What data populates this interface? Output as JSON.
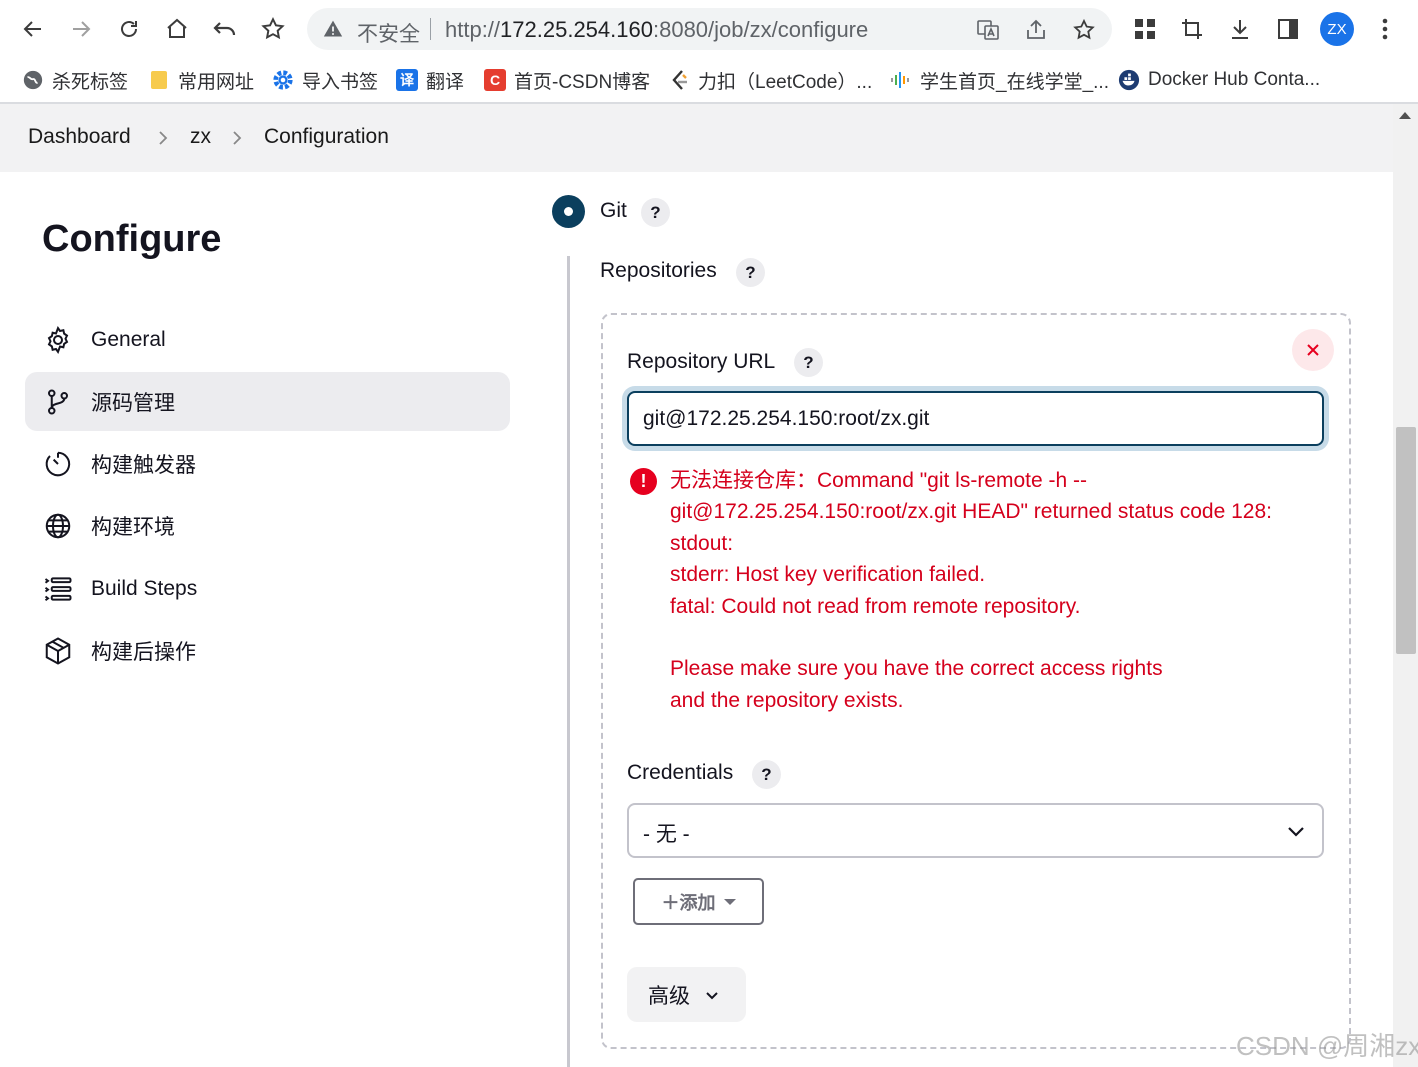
{
  "browser": {
    "omnibox": {
      "security_label": "不安全",
      "url_prefix": "http://",
      "url_host": "172.25.254.160",
      "url_rest": ":8080/job/zx/configure"
    },
    "profile_initials": "ZX",
    "bookmarks": [
      {
        "label": "杀死标签",
        "icon": "globe-icon"
      },
      {
        "label": "常用网址",
        "icon": "folder-icon"
      },
      {
        "label": "导入书签",
        "icon": "gear-icon"
      },
      {
        "label": "翻译",
        "icon_text": "译",
        "icon_color": "#1a73e8"
      },
      {
        "label": "首页-CSDN博客",
        "icon_text": "C",
        "icon_color": "#e53d2f"
      },
      {
        "label": "力扣（LeetCode）...",
        "icon": "leetcode-icon"
      },
      {
        "label": "学生首页_在线学堂_...",
        "icon": "soundwave-icon"
      },
      {
        "label": "Docker Hub Conta...",
        "icon": "docker-icon"
      }
    ]
  },
  "breadcrumb": [
    {
      "label": "Dashboard"
    },
    {
      "label": "zx"
    },
    {
      "label": "Configuration"
    }
  ],
  "sidebar": {
    "title": "Configure",
    "items": [
      {
        "label": "General",
        "icon": "gear-icon",
        "active": false
      },
      {
        "label": "源码管理",
        "icon": "git-branch-icon",
        "active": true
      },
      {
        "label": "构建触发器",
        "icon": "timer-icon",
        "active": false
      },
      {
        "label": "构建环境",
        "icon": "globe-icon",
        "active": false
      },
      {
        "label": "Build Steps",
        "icon": "list-icon",
        "active": false
      },
      {
        "label": "构建后操作",
        "icon": "package-icon",
        "active": false
      }
    ]
  },
  "scm": {
    "option_label": "Git",
    "help_glyph": "?",
    "repositories_label": "Repositories",
    "repository_url_label": "Repository URL",
    "repository_url_value": "git@172.25.254.150:root/zx.git",
    "error_lines": [
      "无法连接仓库：Command \"git ls-remote -h --",
      "git@172.25.254.150:root/zx.git HEAD\" returned status code 128:",
      "stdout:",
      "stderr: Host key verification failed.",
      "fatal: Could not read from remote repository.",
      "",
      "Please make sure you have the correct access rights",
      "and the repository exists."
    ],
    "credentials_label": "Credentials",
    "credentials_selected": "- 无 -",
    "add_button_label": "＋添加",
    "advanced_button_label": "高级"
  },
  "watermark": "CSDN @周湘zx",
  "colors": {
    "accent": "#0b3f5e",
    "error": "#d5001c",
    "active_bg": "#ececef"
  }
}
